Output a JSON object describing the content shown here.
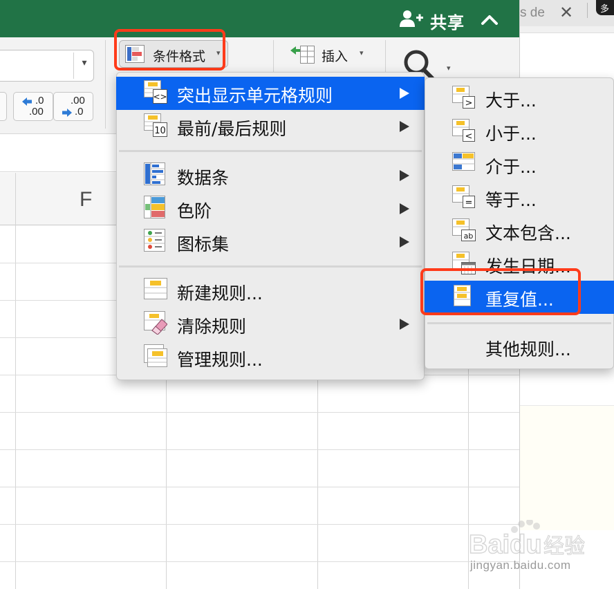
{
  "titlebar": {
    "share_label": "共享",
    "share_icon": "add-person-icon",
    "collapse_icon": "chevron-up-icon"
  },
  "browser": {
    "tab_title": "s de",
    "tab_close": "✕",
    "tab2_text": "多"
  },
  "ribbon": {
    "font_dropdown_arrow": "▾",
    "decrease_decimal": {
      "top": ".0",
      "bottom": ".00"
    },
    "increase_decimal": {
      "top": ".00",
      "bottom": ".0"
    },
    "conditional_format_label": "条件格式",
    "insert_label": "插入",
    "caret": "▾"
  },
  "sheet": {
    "column_header": "F"
  },
  "main_menu": {
    "items": [
      {
        "label": "突出显示单元格规则",
        "icon": "highlight-rules-icon",
        "has_submenu": true,
        "active": true
      },
      {
        "label": "最前/最后规则",
        "icon": "top-bottom-rules-icon",
        "icon_text": "10",
        "has_submenu": true
      },
      {
        "label": "数据条",
        "icon": "data-bars-icon",
        "has_submenu": true
      },
      {
        "label": "色阶",
        "icon": "color-scales-icon",
        "has_submenu": true
      },
      {
        "label": "图标集",
        "icon": "icon-sets-icon",
        "has_submenu": true
      },
      {
        "label": "新建规则...",
        "icon": "new-rule-icon",
        "has_submenu": false
      },
      {
        "label": "清除规则",
        "icon": "clear-rules-icon",
        "has_submenu": true
      },
      {
        "label": "管理规则...",
        "icon": "manage-rules-icon",
        "has_submenu": false
      }
    ]
  },
  "sub_menu": {
    "items": [
      {
        "label": "大于...",
        "icon": "greater-than-icon",
        "icon_text": ">"
      },
      {
        "label": "小于...",
        "icon": "less-than-icon",
        "icon_text": "<"
      },
      {
        "label": "介于...",
        "icon": "between-icon"
      },
      {
        "label": "等于...",
        "icon": "equal-to-icon",
        "icon_text": "="
      },
      {
        "label": "文本包含...",
        "icon": "text-contains-icon",
        "icon_text": "ab"
      },
      {
        "label": "发生日期...",
        "icon": "date-occurring-icon"
      },
      {
        "label": "重复值...",
        "icon": "duplicate-values-icon",
        "active": true
      },
      {
        "label": "其他规则..."
      }
    ]
  },
  "watermark": {
    "brand": "Baidu",
    "brand_cn": "经验",
    "url": "jingyan.baidu.com"
  },
  "colors": {
    "excel_green": "#217346",
    "menu_selection": "#0a64f0",
    "annotation_red": "#ff3b1a"
  }
}
